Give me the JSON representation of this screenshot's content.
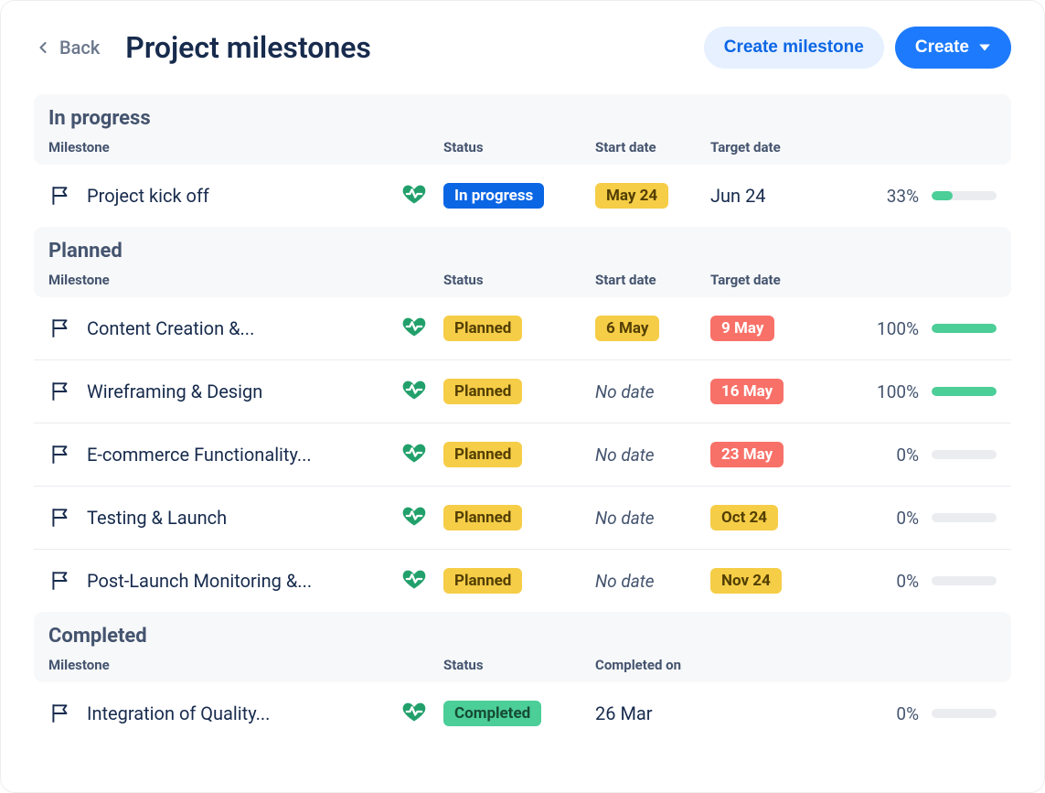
{
  "header": {
    "back_label": "Back",
    "title": "Project milestones",
    "create_milestone_label": "Create milestone",
    "create_label": "Create"
  },
  "columns": {
    "milestone": "Milestone",
    "status": "Status",
    "start_date": "Start date",
    "target_date": "Target date",
    "completed_on": "Completed on"
  },
  "sections": [
    {
      "title": "In progress",
      "header_variant": "default",
      "rows": [
        {
          "name": "Project kick off",
          "status_label": "In progress",
          "status_style": "blue",
          "start_date": "May 24",
          "start_style": "pill-yellow",
          "target_date": "Jun 24",
          "target_style": "plain",
          "percent_label": "33%",
          "percent": 33
        }
      ]
    },
    {
      "title": "Planned",
      "header_variant": "default",
      "rows": [
        {
          "name": "Content Creation &...",
          "status_label": "Planned",
          "status_style": "yellow",
          "start_date": "6 May",
          "start_style": "pill-yellow",
          "target_date": "9 May",
          "target_style": "pill-red",
          "percent_label": "100%",
          "percent": 100
        },
        {
          "name": "Wireframing & Design",
          "status_label": "Planned",
          "status_style": "yellow",
          "start_date": "No date",
          "start_style": "italic",
          "target_date": "16 May",
          "target_style": "pill-red",
          "percent_label": "100%",
          "percent": 100
        },
        {
          "name": "E-commerce Functionality...",
          "status_label": "Planned",
          "status_style": "yellow",
          "start_date": "No date",
          "start_style": "italic",
          "target_date": "23 May",
          "target_style": "pill-red",
          "percent_label": "0%",
          "percent": 0
        },
        {
          "name": "Testing & Launch",
          "status_label": "Planned",
          "status_style": "yellow",
          "start_date": "No date",
          "start_style": "italic",
          "target_date": "Oct 24",
          "target_style": "pill-yellow",
          "percent_label": "0%",
          "percent": 0
        },
        {
          "name": "Post-Launch Monitoring &...",
          "status_label": "Planned",
          "status_style": "yellow",
          "start_date": "No date",
          "start_style": "italic",
          "target_date": "Nov 24",
          "target_style": "pill-yellow",
          "percent_label": "0%",
          "percent": 0
        }
      ]
    },
    {
      "title": "Completed",
      "header_variant": "completed",
      "rows": [
        {
          "name": "Integration of Quality...",
          "status_label": "Completed",
          "status_style": "green",
          "start_date": "26 Mar",
          "start_style": "plain",
          "target_date": "",
          "target_style": "plain",
          "percent_label": "0%",
          "percent": 0
        }
      ]
    }
  ]
}
